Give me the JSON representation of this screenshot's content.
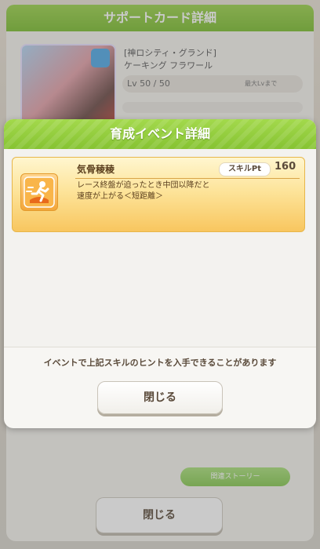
{
  "background": {
    "header_title": "サポートカード詳細",
    "card_name_line1": "[神ロシティ・グランド]",
    "card_name_line2": "ケーキング フラワール",
    "level_text": "Lv 50 / 50",
    "level_right": "最大Lvまで",
    "green_pill_label": "関連ストーリー",
    "close_label": "閉じる"
  },
  "modal": {
    "title": "育成イベント詳細",
    "skill": {
      "icon": "speed-runner-icon",
      "name": "気骨稜稜",
      "pt_label": "スキルPt",
      "pt_value": "160",
      "description": "レース終盤が迫ったとき中団以降だと\n速度が上がる＜短距離＞"
    },
    "notice": "イベントで上記スキルのヒントを入手できることがあります",
    "close_label": "閉じる"
  },
  "colors": {
    "header_green": "#86c332",
    "skill_card_gold": "#f8c65f",
    "text_brown": "#5b3f1e"
  }
}
